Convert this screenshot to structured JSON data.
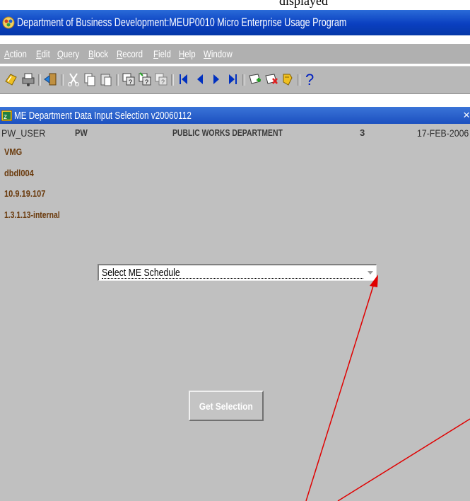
{
  "window": {
    "title": "Department of Business Development:MEUP0010 Micro Enterprise Usage Program"
  },
  "menu": [
    {
      "pre": "",
      "key": "A",
      "post": "ction"
    },
    {
      "pre": "",
      "key": "E",
      "post": "dit"
    },
    {
      "pre": "",
      "key": "Q",
      "post": "uery"
    },
    {
      "pre": "",
      "key": "B",
      "post": "lock"
    },
    {
      "pre": "",
      "key": "R",
      "post": "ecord"
    },
    {
      "pre": "",
      "key": "F",
      "post": "ield"
    },
    {
      "pre": "",
      "key": "H",
      "post": "elp"
    },
    {
      "pre": "",
      "key": "W",
      "post": "indow"
    }
  ],
  "toolbar": {
    "icons": [
      "save-icon",
      "print-icon",
      "exit-icon",
      "cut-icon",
      "copy-icon",
      "paste-icon",
      "enter-query-icon",
      "execute-query-icon",
      "cancel-query-icon",
      "previous-block-icon",
      "previous-record-icon",
      "next-record-icon",
      "next-block-icon",
      "insert-record-icon",
      "delete-record-icon",
      "clear-icon",
      "help-icon"
    ]
  },
  "form": {
    "title": "ME Department Data Input Selection v20060112",
    "close": "×",
    "user_label": "PW_USER",
    "dept_code": "PW",
    "dept_name": "PUBLIC WORKS DEPARTMENT",
    "count": "3",
    "date": "17-FEB-2006",
    "system": "VMG",
    "database": "dbdl004",
    "ip": "10.9.19.107",
    "version": "1.3.1.13-internal",
    "schedule_select": "Select ME Schedule",
    "get_selection": "Get Selection"
  },
  "colors": {
    "title_bar": "#0a3fc0",
    "menu_bar": "#b0b0b0",
    "form_background": "#c0c0c0",
    "info_brown": "#6a3a0c",
    "annotation_arrow": "#e00000"
  }
}
